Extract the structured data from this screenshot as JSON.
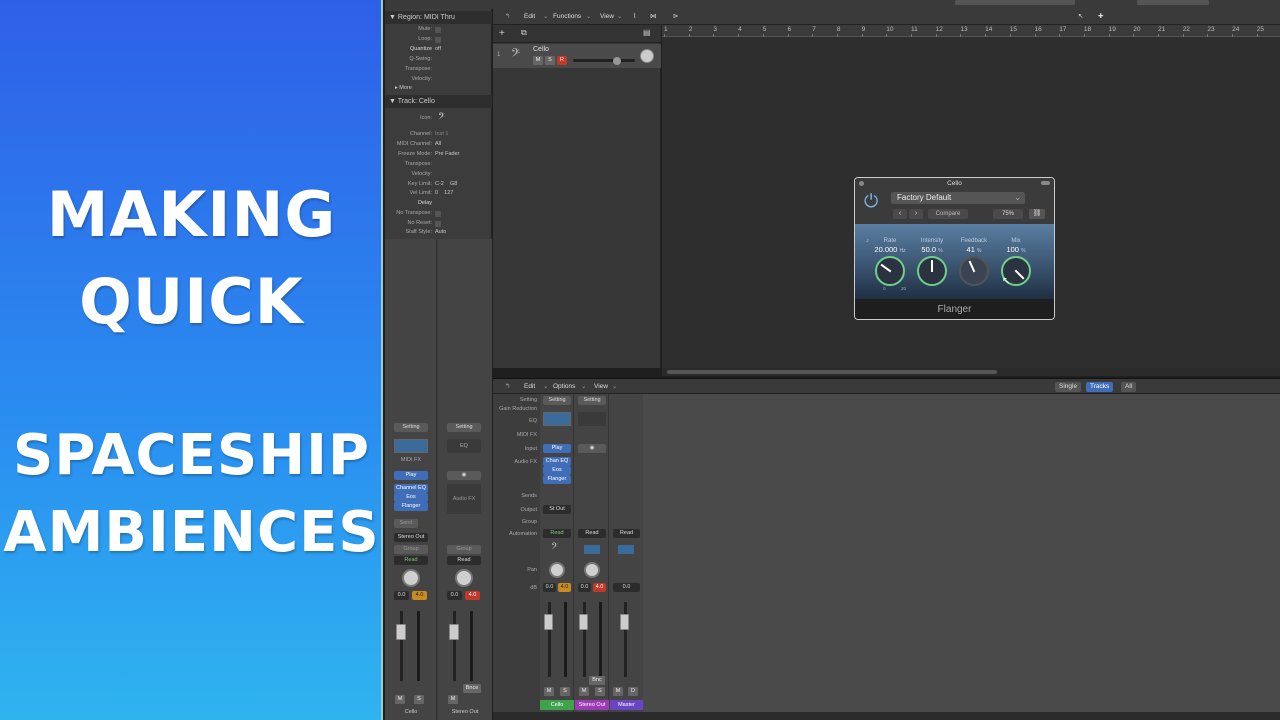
{
  "banner": {
    "line1": "MAKING",
    "line2": "QUICK",
    "line3": "SPACESHIP",
    "line4": "AMBIENCES"
  },
  "inspector": {
    "region_header": "Region: MIDI Thru",
    "region_rows": [
      {
        "label": "Mute:",
        "value": ""
      },
      {
        "label": "Loop:",
        "value": ""
      },
      {
        "label": "Quantize",
        "value": "off"
      },
      {
        "label": "Q-Swing:",
        "value": ""
      },
      {
        "label": "Transpose:",
        "value": ""
      },
      {
        "label": "Velocity:",
        "value": ""
      }
    ],
    "more_label": "More",
    "track_header": "Track: Cello",
    "track_rows": [
      {
        "label": "Icon:",
        "value": ""
      },
      {
        "label": "Channel:",
        "value": "Inst 1"
      },
      {
        "label": "MIDI Channel:",
        "value": "All"
      },
      {
        "label": "Freeze Mode:",
        "value": "Pre Fader"
      },
      {
        "label": "Transpose:",
        "value": ""
      },
      {
        "label": "Velocity:",
        "value": ""
      },
      {
        "label": "Key Limit:",
        "value": "C-2    G8"
      },
      {
        "label": "Vel Limit:",
        "value": "0    127"
      },
      {
        "label": "Delay",
        "value": ""
      },
      {
        "label": "No Transpose:",
        "value": ""
      },
      {
        "label": "No Reset:",
        "value": ""
      },
      {
        "label": "Staff Style:",
        "value": "Auto"
      }
    ],
    "strip1": {
      "setting": "Setting",
      "midi_fx": "MIDI FX",
      "input": "Play",
      "fx": [
        "Channel EQ",
        "Eos",
        "Flanger"
      ],
      "send": "Send",
      "output": "Stereo Out",
      "group": "Group",
      "automation": "Read",
      "vol": "0.0",
      "peak": "4.0",
      "m": "M",
      "s": "S",
      "name": "Cello"
    },
    "strip2": {
      "setting": "Setting",
      "eq": "EQ",
      "audio_fx": "Audio FX",
      "group": "Group",
      "automation": "Read",
      "vol": "0.0",
      "peak": "4.0",
      "m": "M",
      "bnce": "Bnce",
      "name": "Stereo Out"
    }
  },
  "tracks_toolbar": {
    "edit": "Edit",
    "functions": "Functions",
    "view": "View"
  },
  "track": {
    "number": "1",
    "name": "Cello",
    "m": "M",
    "s": "S",
    "r": "R"
  },
  "ruler": [
    "1",
    "2",
    "3",
    "4",
    "5",
    "6",
    "7",
    "8",
    "9",
    "10",
    "11",
    "12",
    "13",
    "14",
    "15",
    "16",
    "17",
    "18",
    "19",
    "20",
    "21",
    "22",
    "23",
    "24",
    "25"
  ],
  "plugin": {
    "title": "Cello",
    "preset": "Factory Default",
    "compare": "Compare",
    "zoom": "75%",
    "name": "Flanger",
    "params": [
      {
        "label": "Rate",
        "value": "20.000",
        "unit": "Hz",
        "level": 0.3
      },
      {
        "label": "Intensity",
        "value": "50.0",
        "unit": "%",
        "level": 0.5
      },
      {
        "label": "Feedback",
        "value": "41",
        "unit": "%",
        "level": 0.41
      },
      {
        "label": "Mix",
        "value": "100",
        "unit": "%",
        "level": 1.0
      }
    ],
    "rate_min": "0",
    "rate_max": "20"
  },
  "mixer_toolbar": {
    "edit": "Edit",
    "options": "Options",
    "view": "View",
    "single": "Single",
    "tracks": "Tracks",
    "all": "All"
  },
  "mixer_labels": [
    "Setting",
    "Gain Reduction",
    "EQ",
    "MIDI FX",
    "Input",
    "Audio FX",
    "Sends",
    "Output",
    "Group",
    "Automation",
    "",
    "Pan",
    "dB"
  ],
  "mixer": {
    "ch1": {
      "setting": "Setting",
      "input": "Play",
      "fx": [
        "Chan EQ",
        "Eos",
        "Flanger"
      ],
      "output": "St Out",
      "automation": "Read",
      "vol": "0.0",
      "peak": "4.0",
      "m": "M",
      "s": "S",
      "name": "Cello",
      "color": "#3fa34d"
    },
    "ch2": {
      "setting": "Setting",
      "automation": "Read",
      "vol": "0.0",
      "peak": "4.0",
      "m": "M",
      "s": "S",
      "bnc": "Bnc",
      "name": "Stereo Out",
      "color": "#9b3bb5"
    },
    "ch3": {
      "automation": "Read",
      "vol": "0.0",
      "m": "M",
      "d": "D",
      "name": "Master",
      "color": "#6a45c2"
    }
  }
}
